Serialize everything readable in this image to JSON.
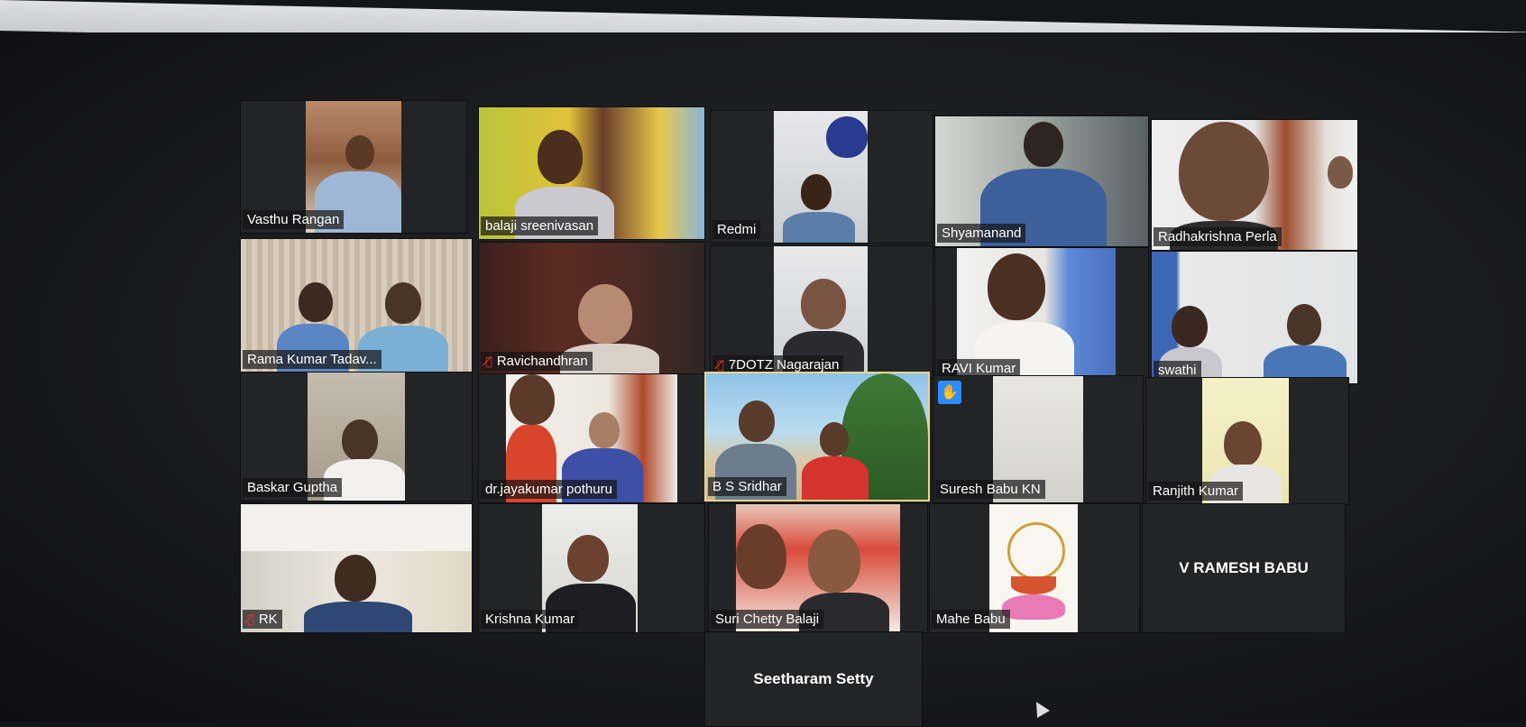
{
  "window": {
    "minimize_icon": "minimize-icon",
    "restore_icon": "restore-icon"
  },
  "participants": [
    "Vasthu Rangan",
    "balaji sreenivasan",
    "Redmi",
    "Shyamanand",
    "Radhakrishna Perla",
    "Rama Kumar Tadav...",
    "Ravichandhran",
    "7DOTZ Nagarajan",
    "RAVI Kumar",
    "swathi",
    "Baskar Guptha",
    "dr.jayakumar pothuru",
    "B S Sridhar",
    "Suresh Babu KN",
    "Ranjith Kumar",
    "RK",
    "Krishna Kumar",
    "Suri Chetty Balaji",
    "Mahe Babu",
    "V RAMESH BABU",
    "Seetharam Setty"
  ],
  "muted_icon": "muted-mic-icon",
  "raised_hand_icon": "raised-hand-icon",
  "colors": {
    "active_speaker": "#e8d58a",
    "mute": "#e0352b",
    "hand": "#2d8cff"
  }
}
